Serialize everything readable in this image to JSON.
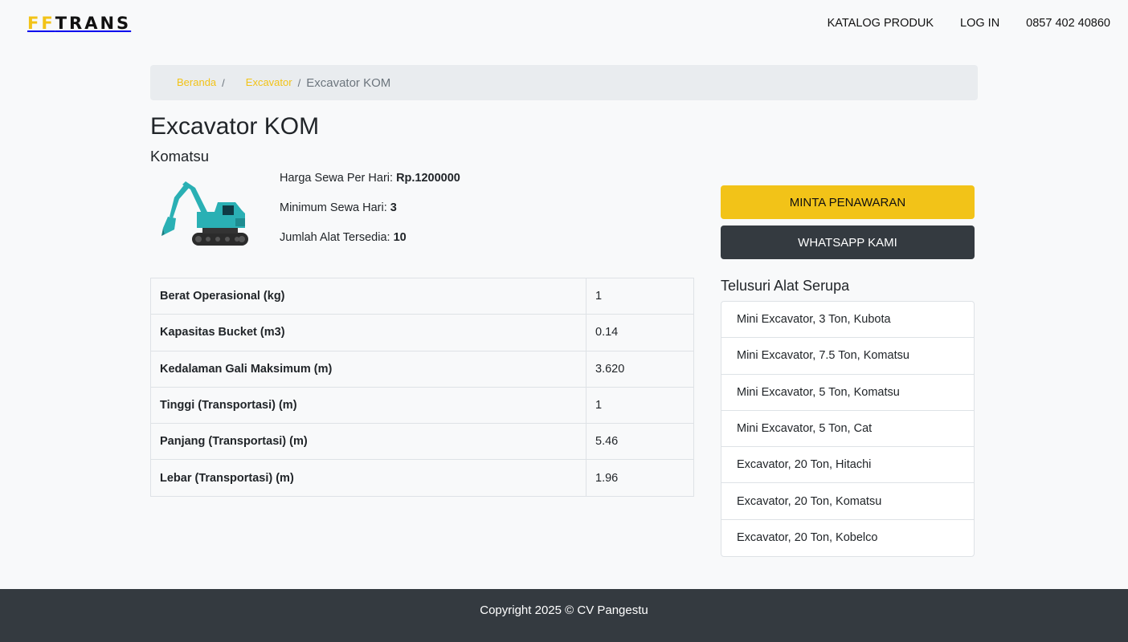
{
  "navbar": {
    "brand_ff": "FF",
    "brand_trans": "TRANS",
    "links": [
      "KATALOG PRODUK",
      "LOG IN",
      "0857 402 40860"
    ]
  },
  "breadcrumb": {
    "home": "Beranda",
    "category": "Excavator",
    "current": "Excavator KOM",
    "separator": "/"
  },
  "product": {
    "title": "Excavator KOM",
    "brand": "Komatsu",
    "image_icon": "excavator-image",
    "price_label": "Harga Sewa Per Hari: ",
    "price_value": "Rp.1200000",
    "min_days_label": "Minimum Sewa Hari: ",
    "min_days_value": "3",
    "stock_label": "Jumlah Alat Tersedia: ",
    "stock_value": "10"
  },
  "specs": [
    {
      "label": "Berat Operasional (kg)",
      "value": "1"
    },
    {
      "label": "Kapasitas Bucket (m3)",
      "value": "0.14"
    },
    {
      "label": "Kedalaman Gali Maksimum (m)",
      "value": "3.620"
    },
    {
      "label": "Tinggi (Transportasi) (m)",
      "value": "1"
    },
    {
      "label": "Panjang (Transportasi) (m)",
      "value": "5.46"
    },
    {
      "label": "Lebar (Transportasi) (m)",
      "value": "1.96"
    }
  ],
  "actions": {
    "quote_label": "MINTA PENAWARAN",
    "whatsapp_label": "WHATSAPP KAMI"
  },
  "similar": {
    "title": "Telusuri Alat Serupa",
    "items": [
      "Mini Excavator, 3 Ton, Kubota",
      "Mini Excavator, 7.5 Ton, Komatsu",
      "Mini Excavator, 5 Ton, Komatsu",
      "Mini Excavator, 5 Ton, Cat",
      "Excavator, 20 Ton, Hitachi",
      "Excavator, 20 Ton, Komatsu",
      "Excavator, 20 Ton, Kobelco"
    ]
  },
  "footer": {
    "copyright": "Copyright 2025 © CV Pangestu"
  },
  "colors": {
    "accent": "#f2c318",
    "dark": "#343a40",
    "background": "#f8f9fa",
    "excavator_body": "#2ab0b4"
  }
}
